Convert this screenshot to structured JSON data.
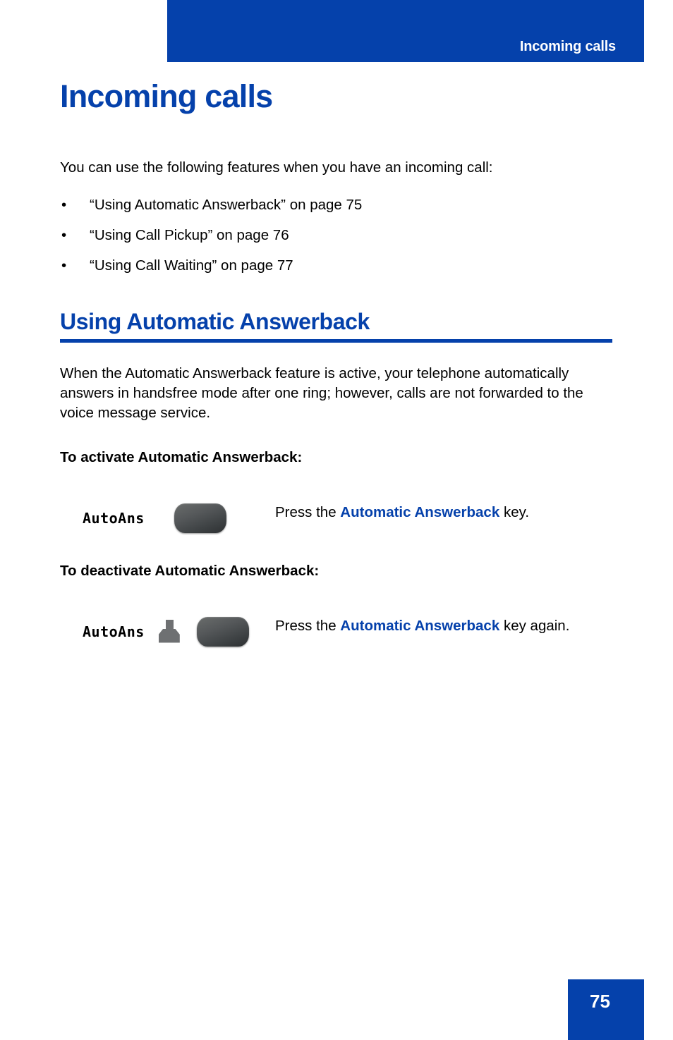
{
  "header": {
    "running_title": "Incoming calls",
    "bar_color": "#0541ab"
  },
  "page_title": "Incoming calls",
  "intro": "You can use the following features when you have an incoming call:",
  "bullets": [
    {
      "marker": "•",
      "text": "“Using Automatic Answerback” on page 75"
    },
    {
      "marker": "•",
      "text": "“Using Call Pickup” on page 76"
    },
    {
      "marker": "•",
      "text": "“Using Call Waiting” on page 77"
    }
  ],
  "section": {
    "heading": "Using Automatic Answerback",
    "paragraph": "When the Automatic Answerback feature is active, your telephone automatically answers in handsfree mode after one ring; however, calls are not forwarded to the voice message service."
  },
  "procedures": [
    {
      "heading": "To activate Automatic Answerback:",
      "lcd_label": "AutoAns",
      "has_indicator": false,
      "indicator_icon": "",
      "key_icon": "feature-key-icon",
      "text_before": "Press the ",
      "feature_name": "Automatic Answerback",
      "text_after": " key."
    },
    {
      "heading": "To deactivate Automatic Answerback:",
      "lcd_label": "AutoAns",
      "has_indicator": true,
      "indicator_icon": "lcd-active-indicator-icon",
      "key_icon": "feature-key-icon",
      "text_before": "Press the ",
      "feature_name": "Automatic Answerback",
      "text_after": " key again."
    }
  ],
  "footer": {
    "page_number": "75",
    "block_color": "#0541ab"
  }
}
